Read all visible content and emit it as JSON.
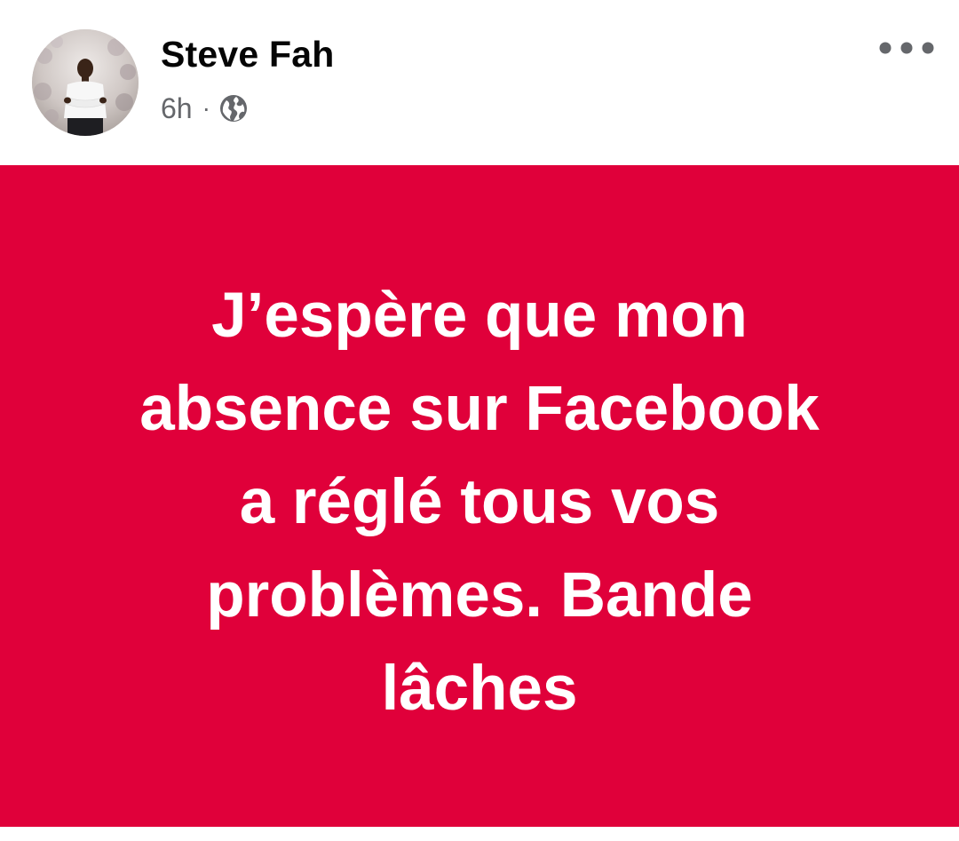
{
  "post": {
    "author": {
      "name": "Steve Fah",
      "avatar_icon": "profile-photo"
    },
    "timestamp": "6h",
    "separator": "·",
    "audience_icon": "globe-icon",
    "more_icon": "more-options-icon",
    "text": "J’espère que mon\nabsence sur Facebook\na réglé tous vos\nproblèmes. Bande\nlâches",
    "background_color": "#e0003a",
    "text_color": "#ffffff"
  }
}
